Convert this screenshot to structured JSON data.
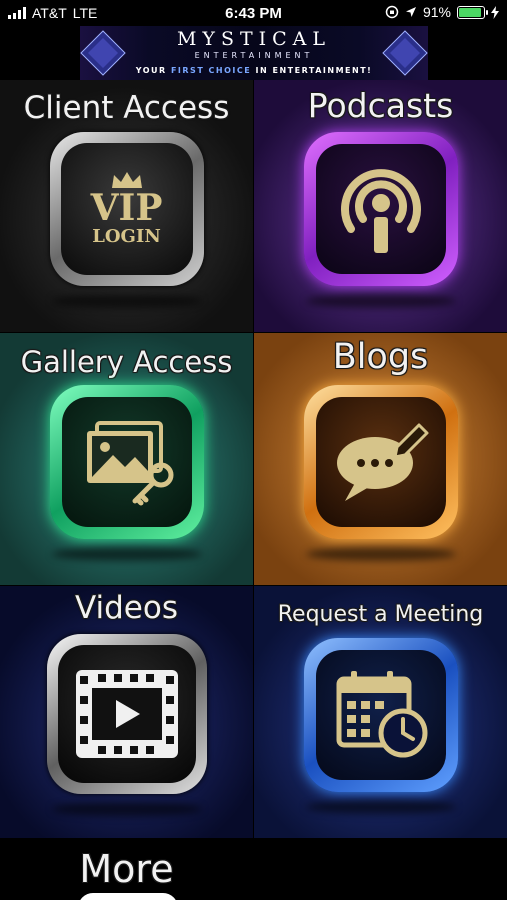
{
  "status_bar": {
    "carrier": "AT&T",
    "network": "LTE",
    "time": "6:43 PM",
    "battery_percent": "91%",
    "battery_level": 0.91
  },
  "banner": {
    "title": "MYSTICAL",
    "subtitle": "ENTERTAINMENT",
    "tagline_pre": "YOUR",
    "tagline_hl": "FIRST CHOICE",
    "tagline_post": "IN ENTERTAINMENT!"
  },
  "tiles": {
    "client_access": {
      "label": "Client Access",
      "icon_text_1": "VIP",
      "icon_text_2": "LOGIN",
      "icon": "vip-login-icon"
    },
    "podcasts": {
      "label": "Podcasts",
      "icon": "podcast-icon"
    },
    "gallery_access": {
      "label": "Gallery Access",
      "icon": "gallery-key-icon"
    },
    "blogs": {
      "label": "Blogs",
      "icon": "chat-pencil-icon"
    },
    "videos": {
      "label": "Videos",
      "icon": "film-play-icon"
    },
    "request_meeting": {
      "label": "Request a Meeting",
      "icon": "calendar-clock-icon"
    },
    "more": {
      "label": "More"
    }
  },
  "colors": {
    "client_ring": "#c8c8c8",
    "podcast_ring": "#b040f0",
    "gallery_ring": "#30e090",
    "blog_ring": "#ffb040",
    "video_ring": "#f0f0f0",
    "meeting_ring": "#3a8cff",
    "gold": "#d6c48a"
  }
}
